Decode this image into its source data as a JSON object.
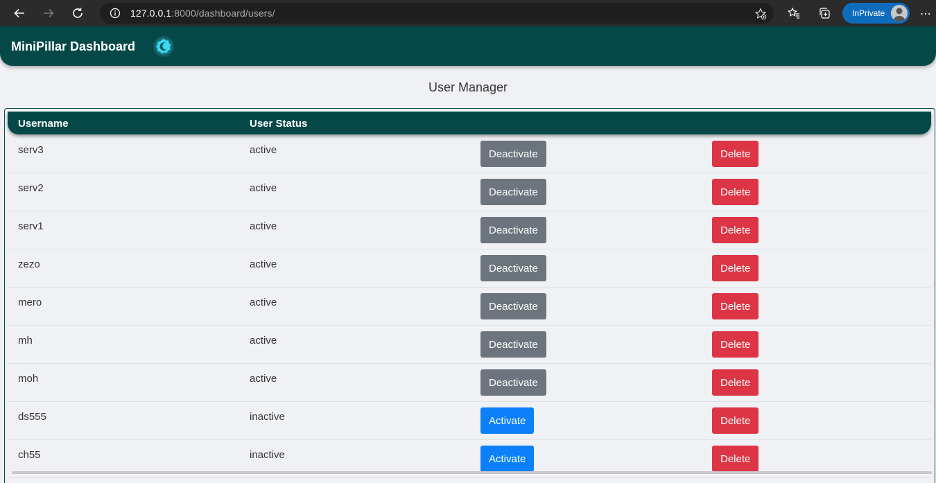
{
  "browser": {
    "url_host": "127.0.0.1",
    "url_path": ":8000/dashboard/users/",
    "inprivate_label": "InPrivate"
  },
  "header": {
    "brand": "MiniPillar Dashboard"
  },
  "page": {
    "title": "User Manager"
  },
  "table": {
    "columns": [
      "Username",
      "User Status",
      "",
      ""
    ],
    "rows": [
      {
        "username": "serv3",
        "status": "active",
        "toggle_label": "Deactivate",
        "delete_label": "Delete"
      },
      {
        "username": "serv2",
        "status": "active",
        "toggle_label": "Deactivate",
        "delete_label": "Delete"
      },
      {
        "username": "serv1",
        "status": "active",
        "toggle_label": "Deactivate",
        "delete_label": "Delete"
      },
      {
        "username": "zezo",
        "status": "active",
        "toggle_label": "Deactivate",
        "delete_label": "Delete"
      },
      {
        "username": "mero",
        "status": "active",
        "toggle_label": "Deactivate",
        "delete_label": "Delete"
      },
      {
        "username": "mh",
        "status": "active",
        "toggle_label": "Deactivate",
        "delete_label": "Delete"
      },
      {
        "username": "moh",
        "status": "active",
        "toggle_label": "Deactivate",
        "delete_label": "Delete"
      },
      {
        "username": "ds555",
        "status": "inactive",
        "toggle_label": "Activate",
        "delete_label": "Delete"
      },
      {
        "username": "ch55",
        "status": "inactive",
        "toggle_label": "Activate",
        "delete_label": "Delete"
      }
    ]
  },
  "colors": {
    "header_bg": "#064848",
    "deactivate": "#6c757d",
    "activate": "#0b80f8",
    "delete": "#dc3545"
  },
  "icons": [
    "back-arrow-icon",
    "forward-arrow-icon",
    "refresh-icon",
    "info-icon",
    "favorite-add-icon",
    "favorites-icon",
    "collections-icon",
    "more-icon",
    "logo-icon"
  ]
}
